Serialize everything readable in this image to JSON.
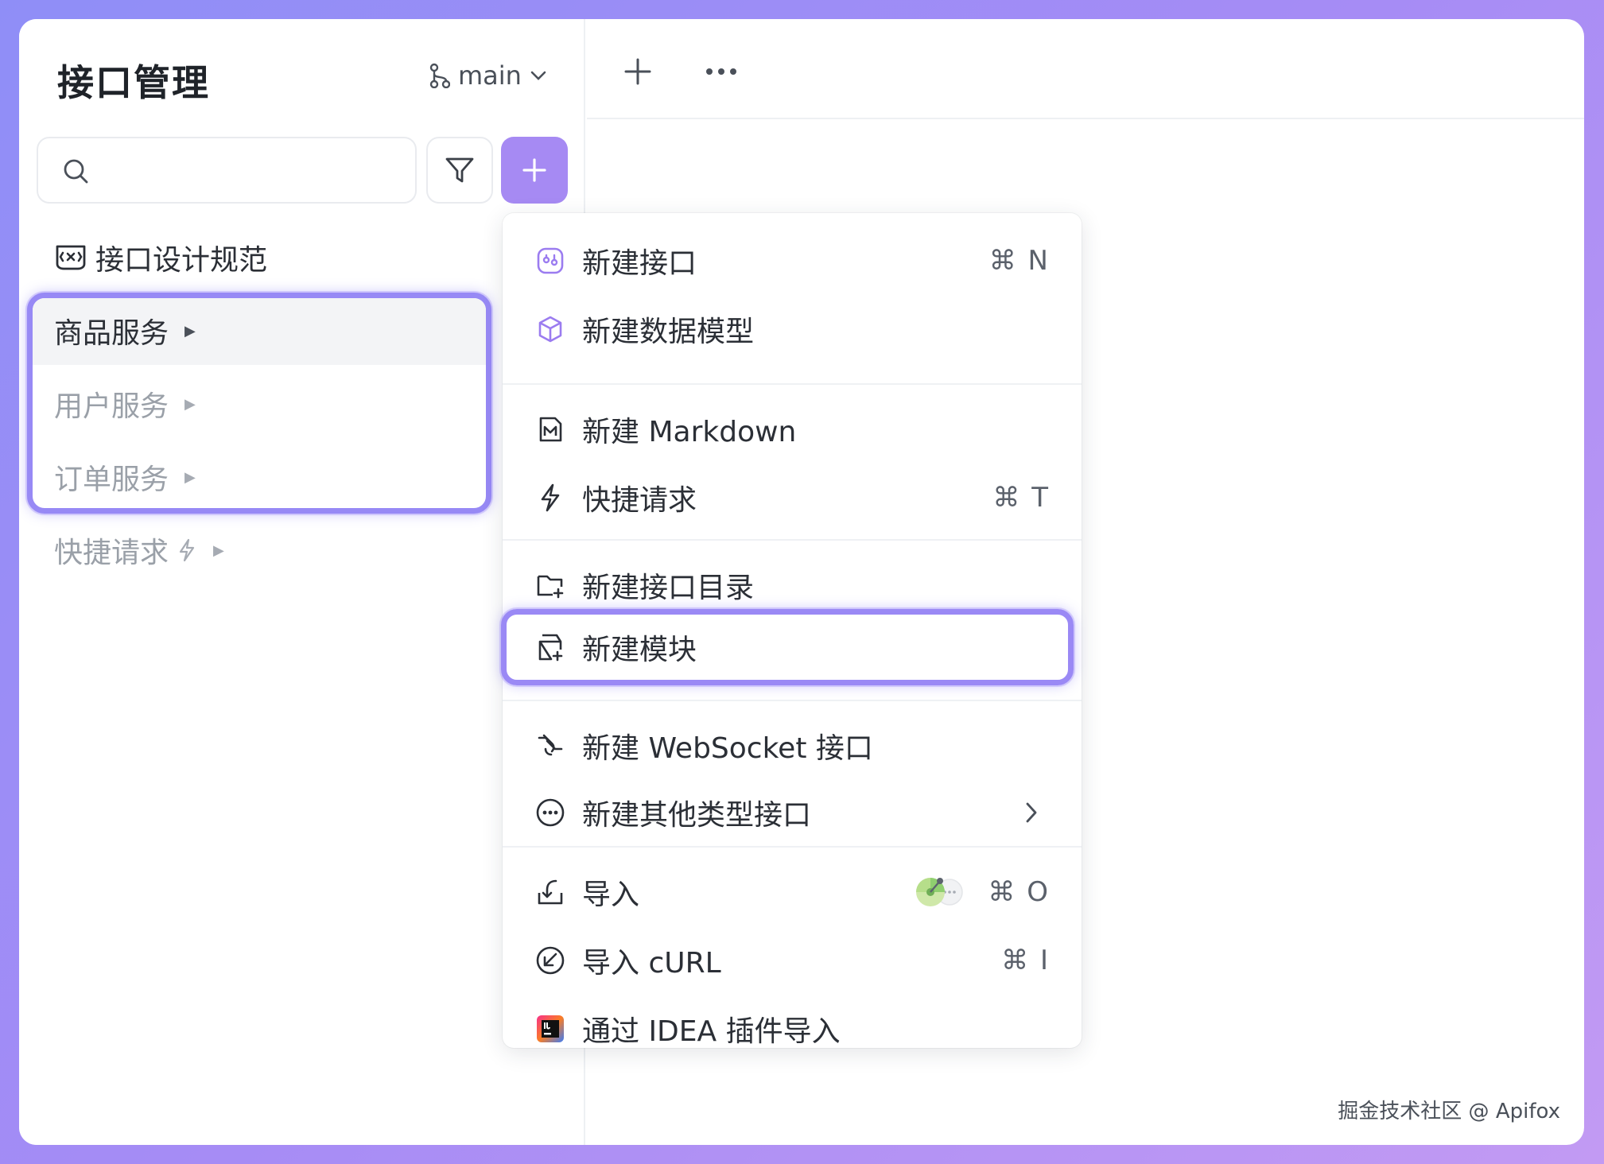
{
  "sidebar": {
    "title": "接口管理",
    "branch": "main",
    "search_placeholder": "",
    "items": [
      {
        "label": "接口设计规范",
        "icon": "api-spec-icon"
      },
      {
        "label": "商品服务",
        "icon": "caret-right-icon"
      },
      {
        "label": "用户服务",
        "icon": "caret-right-icon"
      },
      {
        "label": "订单服务",
        "icon": "caret-right-icon"
      },
      {
        "label": "快捷请求",
        "icon": "bolt-icon"
      }
    ]
  },
  "menu": {
    "items": [
      {
        "label": "新建接口",
        "shortcut": "⌘ N",
        "icon": "api-icon"
      },
      {
        "label": "新建数据模型",
        "shortcut": "",
        "icon": "cube-icon"
      },
      {
        "label": "新建 Markdown",
        "shortcut": "",
        "icon": "markdown-icon"
      },
      {
        "label": "快捷请求",
        "shortcut": "⌘ T",
        "icon": "bolt-icon"
      },
      {
        "label": "新建接口目录",
        "shortcut": "",
        "icon": "folder-add-icon"
      },
      {
        "label": "新建模块",
        "shortcut": "",
        "icon": "module-add-icon"
      },
      {
        "label": "新建 WebSocket 接口",
        "shortcut": "",
        "icon": "websocket-icon"
      },
      {
        "label": "新建其他类型接口",
        "shortcut": "",
        "icon": "more-circle-icon"
      },
      {
        "label": "导入",
        "shortcut": "⌘ O",
        "icon": "import-icon"
      },
      {
        "label": "导入 cURL",
        "shortcut": "⌘ I",
        "icon": "curl-icon"
      },
      {
        "label": "通过 IDEA 插件导入",
        "shortcut": "",
        "icon": "idea-icon"
      }
    ]
  },
  "watermark": "掘金技术社区 @ Apifox",
  "colors": {
    "accent": "#a68af3",
    "highlight_border": "#9789f5",
    "text": "#2b2f36",
    "muted": "#9aa0a8"
  }
}
